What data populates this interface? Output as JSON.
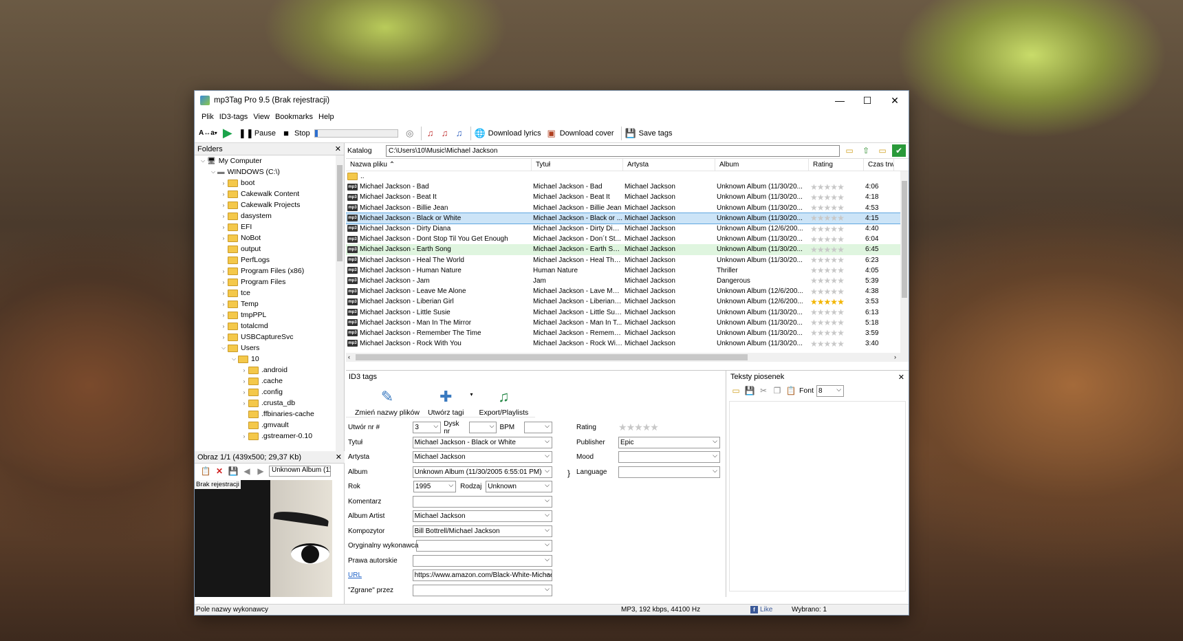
{
  "window": {
    "title": "mp3Tag Pro 9.5 (Brak rejestracji)",
    "minimize": "—",
    "maximize": "☐",
    "close": "✕"
  },
  "menu": [
    "Plik",
    "ID3-tags",
    "View",
    "Bookmarks",
    "Help"
  ],
  "toolbar": {
    "case_label": "A↔a",
    "play_icon": "▶",
    "pause_label": "Pause",
    "stop_label": "Stop",
    "progress": 0.04,
    "download_lyrics": "Download lyrics",
    "download_cover": "Download cover",
    "save_tags": "Save tags"
  },
  "folders": {
    "title": "Folders",
    "close": "✕",
    "items": [
      {
        "label": "My Computer",
        "level": 0,
        "exp": "⌵",
        "kind": "computer"
      },
      {
        "label": "WINDOWS (C:\\)",
        "level": 1,
        "exp": "⌵",
        "kind": "drive"
      },
      {
        "label": "boot",
        "level": 2,
        "exp": "›"
      },
      {
        "label": "Cakewalk Content",
        "level": 2,
        "exp": "›"
      },
      {
        "label": "Cakewalk Projects",
        "level": 2,
        "exp": "›"
      },
      {
        "label": "dasystem",
        "level": 2,
        "exp": "›"
      },
      {
        "label": "EFI",
        "level": 2,
        "exp": "›"
      },
      {
        "label": "NoBot",
        "level": 2,
        "exp": "›"
      },
      {
        "label": "output",
        "level": 2,
        "exp": ""
      },
      {
        "label": "PerfLogs",
        "level": 2,
        "exp": ""
      },
      {
        "label": "Program Files (x86)",
        "level": 2,
        "exp": "›"
      },
      {
        "label": "Program Files",
        "level": 2,
        "exp": "›"
      },
      {
        "label": "tce",
        "level": 2,
        "exp": "›"
      },
      {
        "label": "Temp",
        "level": 2,
        "exp": "›"
      },
      {
        "label": "tmpPPL",
        "level": 2,
        "exp": "›"
      },
      {
        "label": "totalcmd",
        "level": 2,
        "exp": "›"
      },
      {
        "label": "USBCaptureSvc",
        "level": 2,
        "exp": "›"
      },
      {
        "label": "Users",
        "level": 2,
        "exp": "⌵"
      },
      {
        "label": "10",
        "level": 3,
        "exp": "⌵"
      },
      {
        "label": ".android",
        "level": 4,
        "exp": "›"
      },
      {
        "label": ".cache",
        "level": 4,
        "exp": "›"
      },
      {
        "label": ".config",
        "level": 4,
        "exp": "›"
      },
      {
        "label": ".crusta_db",
        "level": 4,
        "exp": "›"
      },
      {
        "label": ".ffbinaries-cache",
        "level": 4,
        "exp": ""
      },
      {
        "label": ".gmvault",
        "level": 4,
        "exp": ""
      },
      {
        "label": ".gstreamer-0.10",
        "level": 4,
        "exp": "›"
      }
    ]
  },
  "image_panel": {
    "title": "Obraz 1/1 (439x500; 29,37 Kb)",
    "close": "✕",
    "album_field": "Unknown Album (11",
    "watermark": "Brak rejestracji"
  },
  "katalog": {
    "label": "Katalog",
    "path": "C:\\Users\\10\\Music\\Michael Jackson"
  },
  "grid": {
    "columns": [
      "Nazwa pliku ⌃",
      "Tytuł",
      "Artysta",
      "Album",
      "Rating",
      "Czas trwa"
    ],
    "parent": "..",
    "rows": [
      {
        "file": "Michael Jackson - Bad",
        "title": "Michael Jackson - Bad",
        "artist": "Michael Jackson",
        "album": "Unknown Album (11/30/20...",
        "rating": 0,
        "time": "4:06"
      },
      {
        "file": "Michael Jackson - Beat It",
        "title": "Michael Jackson - Beat It",
        "artist": "Michael Jackson",
        "album": "Unknown Album (11/30/20...",
        "rating": 0,
        "time": "4:18"
      },
      {
        "file": "Michael Jackson - Billie Jean",
        "title": "Michael Jackson - Billie Jean",
        "artist": "Michael Jackson",
        "album": "Unknown Album (11/30/20...",
        "rating": 0,
        "time": "4:53"
      },
      {
        "file": "Michael Jackson - Black or White",
        "title": "Michael Jackson - Black or ...",
        "artist": "Michael Jackson",
        "album": "Unknown Album (11/30/20...",
        "rating": 0,
        "time": "4:15",
        "state": "selected"
      },
      {
        "file": "Michael Jackson - Dirty Diana",
        "title": "Michael Jackson - Dirty Diana",
        "artist": "Michael Jackson",
        "album": "Unknown Album (12/6/200...",
        "rating": 0,
        "time": "4:40"
      },
      {
        "file": "Michael Jackson - Dont Stop Til You Get Enough",
        "title": "Michael Jackson - Don´t St...",
        "artist": "Michael Jackson",
        "album": "Unknown Album (11/30/20...",
        "rating": 0,
        "time": "6:04"
      },
      {
        "file": "Michael Jackson - Earth Song",
        "title": "Michael Jackson - Earth Song",
        "artist": "Michael Jackson",
        "album": "Unknown Album (11/30/20...",
        "rating": 0,
        "time": "6:45",
        "state": "playing"
      },
      {
        "file": "Michael Jackson - Heal The World",
        "title": "Michael Jackson - Heal The...",
        "artist": "Michael Jackson",
        "album": "Unknown Album (11/30/20...",
        "rating": 0,
        "time": "6:23"
      },
      {
        "file": "Michael Jackson - Human Nature",
        "title": "Human Nature",
        "artist": "Michael Jackson",
        "album": "Thriller",
        "rating": 0,
        "time": "4:05"
      },
      {
        "file": "Michael Jackson - Jam",
        "title": "Jam",
        "artist": "Michael Jackson",
        "album": "Dangerous",
        "rating": 0,
        "time": "5:39"
      },
      {
        "file": "Michael Jackson - Leave Me Alone",
        "title": "Michael Jackson - Lave Me ...",
        "artist": "Michael Jackson",
        "album": "Unknown Album (12/6/200...",
        "rating": 0,
        "time": "4:38"
      },
      {
        "file": "Michael Jackson - Liberian Girl",
        "title": "Michael Jackson - Liberian Girl",
        "artist": "Michael Jackson",
        "album": "Unknown Album (12/6/200...",
        "rating": 5,
        "time": "3:53"
      },
      {
        "file": "Michael Jackson - Little Susie",
        "title": "Michael Jackson - Little Susie",
        "artist": "Michael Jackson",
        "album": "Unknown Album (11/30/20...",
        "rating": 0,
        "time": "6:13"
      },
      {
        "file": "Michael Jackson - Man In The Mirror",
        "title": "Michael Jackson - Man In T...",
        "artist": "Michael Jackson",
        "album": "Unknown Album (11/30/20...",
        "rating": 0,
        "time": "5:18"
      },
      {
        "file": "Michael Jackson - Remember The Time",
        "title": "Michael Jackson - Rememb...",
        "artist": "Michael Jackson",
        "album": "Unknown Album (11/30/20...",
        "rating": 0,
        "time": "3:59"
      },
      {
        "file": "Michael Jackson - Rock With You",
        "title": "Michael Jackson - Rock Wit...",
        "artist": "Michael Jackson",
        "album": "Unknown Album (11/30/20...",
        "rating": 0,
        "time": "3:40"
      }
    ]
  },
  "id3": {
    "title": "ID3 tags",
    "btn_rename": "Zmień nazwy plików",
    "btn_create": "Utwórz tagi",
    "btn_export": "Export/Playlists",
    "track_label": "Utwór nr #",
    "track": "3",
    "disc_label": "Dysk nr",
    "disc": "",
    "bpm_label": "BPM",
    "bpm": "",
    "title_label": "Tytuł",
    "title_val": "Michael Jackson - Black or White",
    "artist_label": "Artysta",
    "artist_val": "Michael Jackson",
    "album_label": "Album",
    "album_val": "Unknown Album (11/30/2005 6:55:01 PM)",
    "year_label": "Rok",
    "year_val": "1995",
    "genre_label": "Rodzaj",
    "genre_val": "Unknown",
    "comment_label": "Komentarz",
    "comment_val": "",
    "albumartist_label": "Album Artist",
    "albumartist_val": "Michael Jackson",
    "composer_label": "Kompozytor",
    "composer_val": "Bill Bottrell/Michael Jackson",
    "orig_label": "Oryginalny wykonawca",
    "orig_val": "",
    "copyright_label": "Prawa autorskie",
    "copyright_val": "",
    "url_label": "URL",
    "url_val": "https://www.amazon.com/Black-White-Michae",
    "ripped_label": "\"Zgrane\" przez",
    "ripped_val": "",
    "rating_label": "Rating",
    "rating": 0,
    "brace": "}",
    "publisher_label": "Publisher",
    "publisher_val": "Epic",
    "mood_label": "Mood",
    "mood_val": "",
    "language_label": "Language",
    "language_val": ""
  },
  "lyrics": {
    "title": "Teksty piosenek",
    "close": "✕",
    "font_label": "Font",
    "font_size": "8"
  },
  "status": {
    "left": "Pole nazwy wykonawcy",
    "info": "MP3, 192 kbps, 44100 Hz",
    "like": "Like",
    "selected": "Wybrano: 1"
  }
}
